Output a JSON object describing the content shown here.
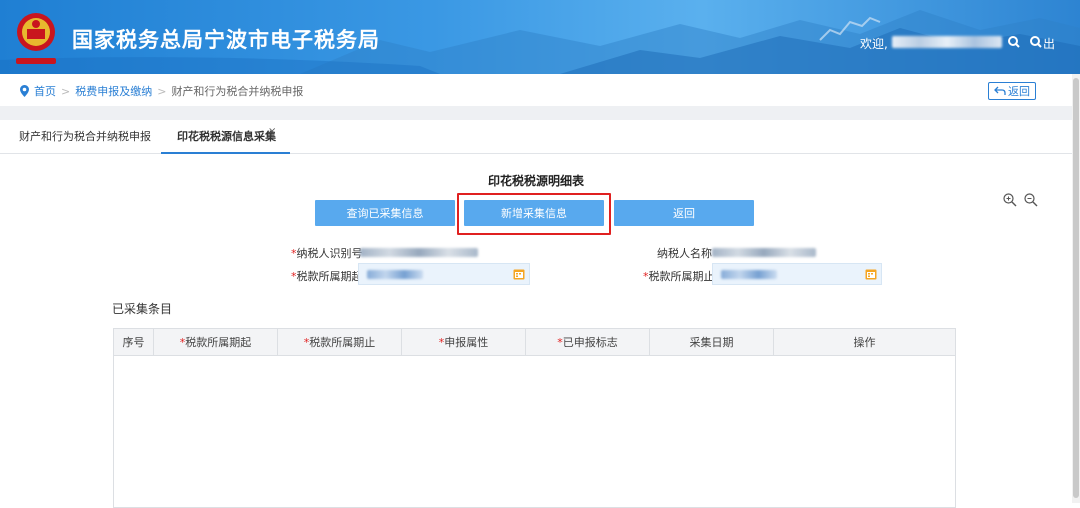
{
  "header": {
    "site_title": "国家税务总局宁波市电子税务局",
    "welcome_label": "欢迎,",
    "logout_label": "出",
    "emblem_icon": "tax-emblem-icon",
    "brand_colors": {
      "header_start": "#1f7fd3",
      "header_end": "#2d84d2"
    }
  },
  "breadcrumb": {
    "home": "首页",
    "level1": "税费申报及缴纳",
    "current": "财产和行为税合并纳税申报",
    "back_label": "返回"
  },
  "tabs": [
    {
      "label": "财产和行为税合并纳税申报",
      "active": false
    },
    {
      "label": "印花税税源信息采集",
      "active": true,
      "close": "×"
    }
  ],
  "form": {
    "title": "印花税税源明细表",
    "buttons": {
      "query": "查询已采集信息",
      "new": "新增采集信息",
      "return": "返回"
    },
    "fields": {
      "taxpayer_id_label": "纳税人识别号",
      "taxpayer_name_label": "纳税人名称",
      "period_start_label": "税款所属期起",
      "period_end_label": "税款所属期止",
      "required_mark": "*"
    }
  },
  "collected": {
    "section_title": "已采集条目",
    "columns": [
      {
        "label": "序号",
        "required": false
      },
      {
        "label": "税款所属期起",
        "required": true
      },
      {
        "label": "税款所属期止",
        "required": true
      },
      {
        "label": "申报属性",
        "required": true
      },
      {
        "label": "已申报标志",
        "required": true
      },
      {
        "label": "采集日期",
        "required": false
      },
      {
        "label": "操作",
        "required": false
      }
    ],
    "rows": []
  },
  "accent_color": "#58a9ee",
  "highlight_color": "#e02020"
}
